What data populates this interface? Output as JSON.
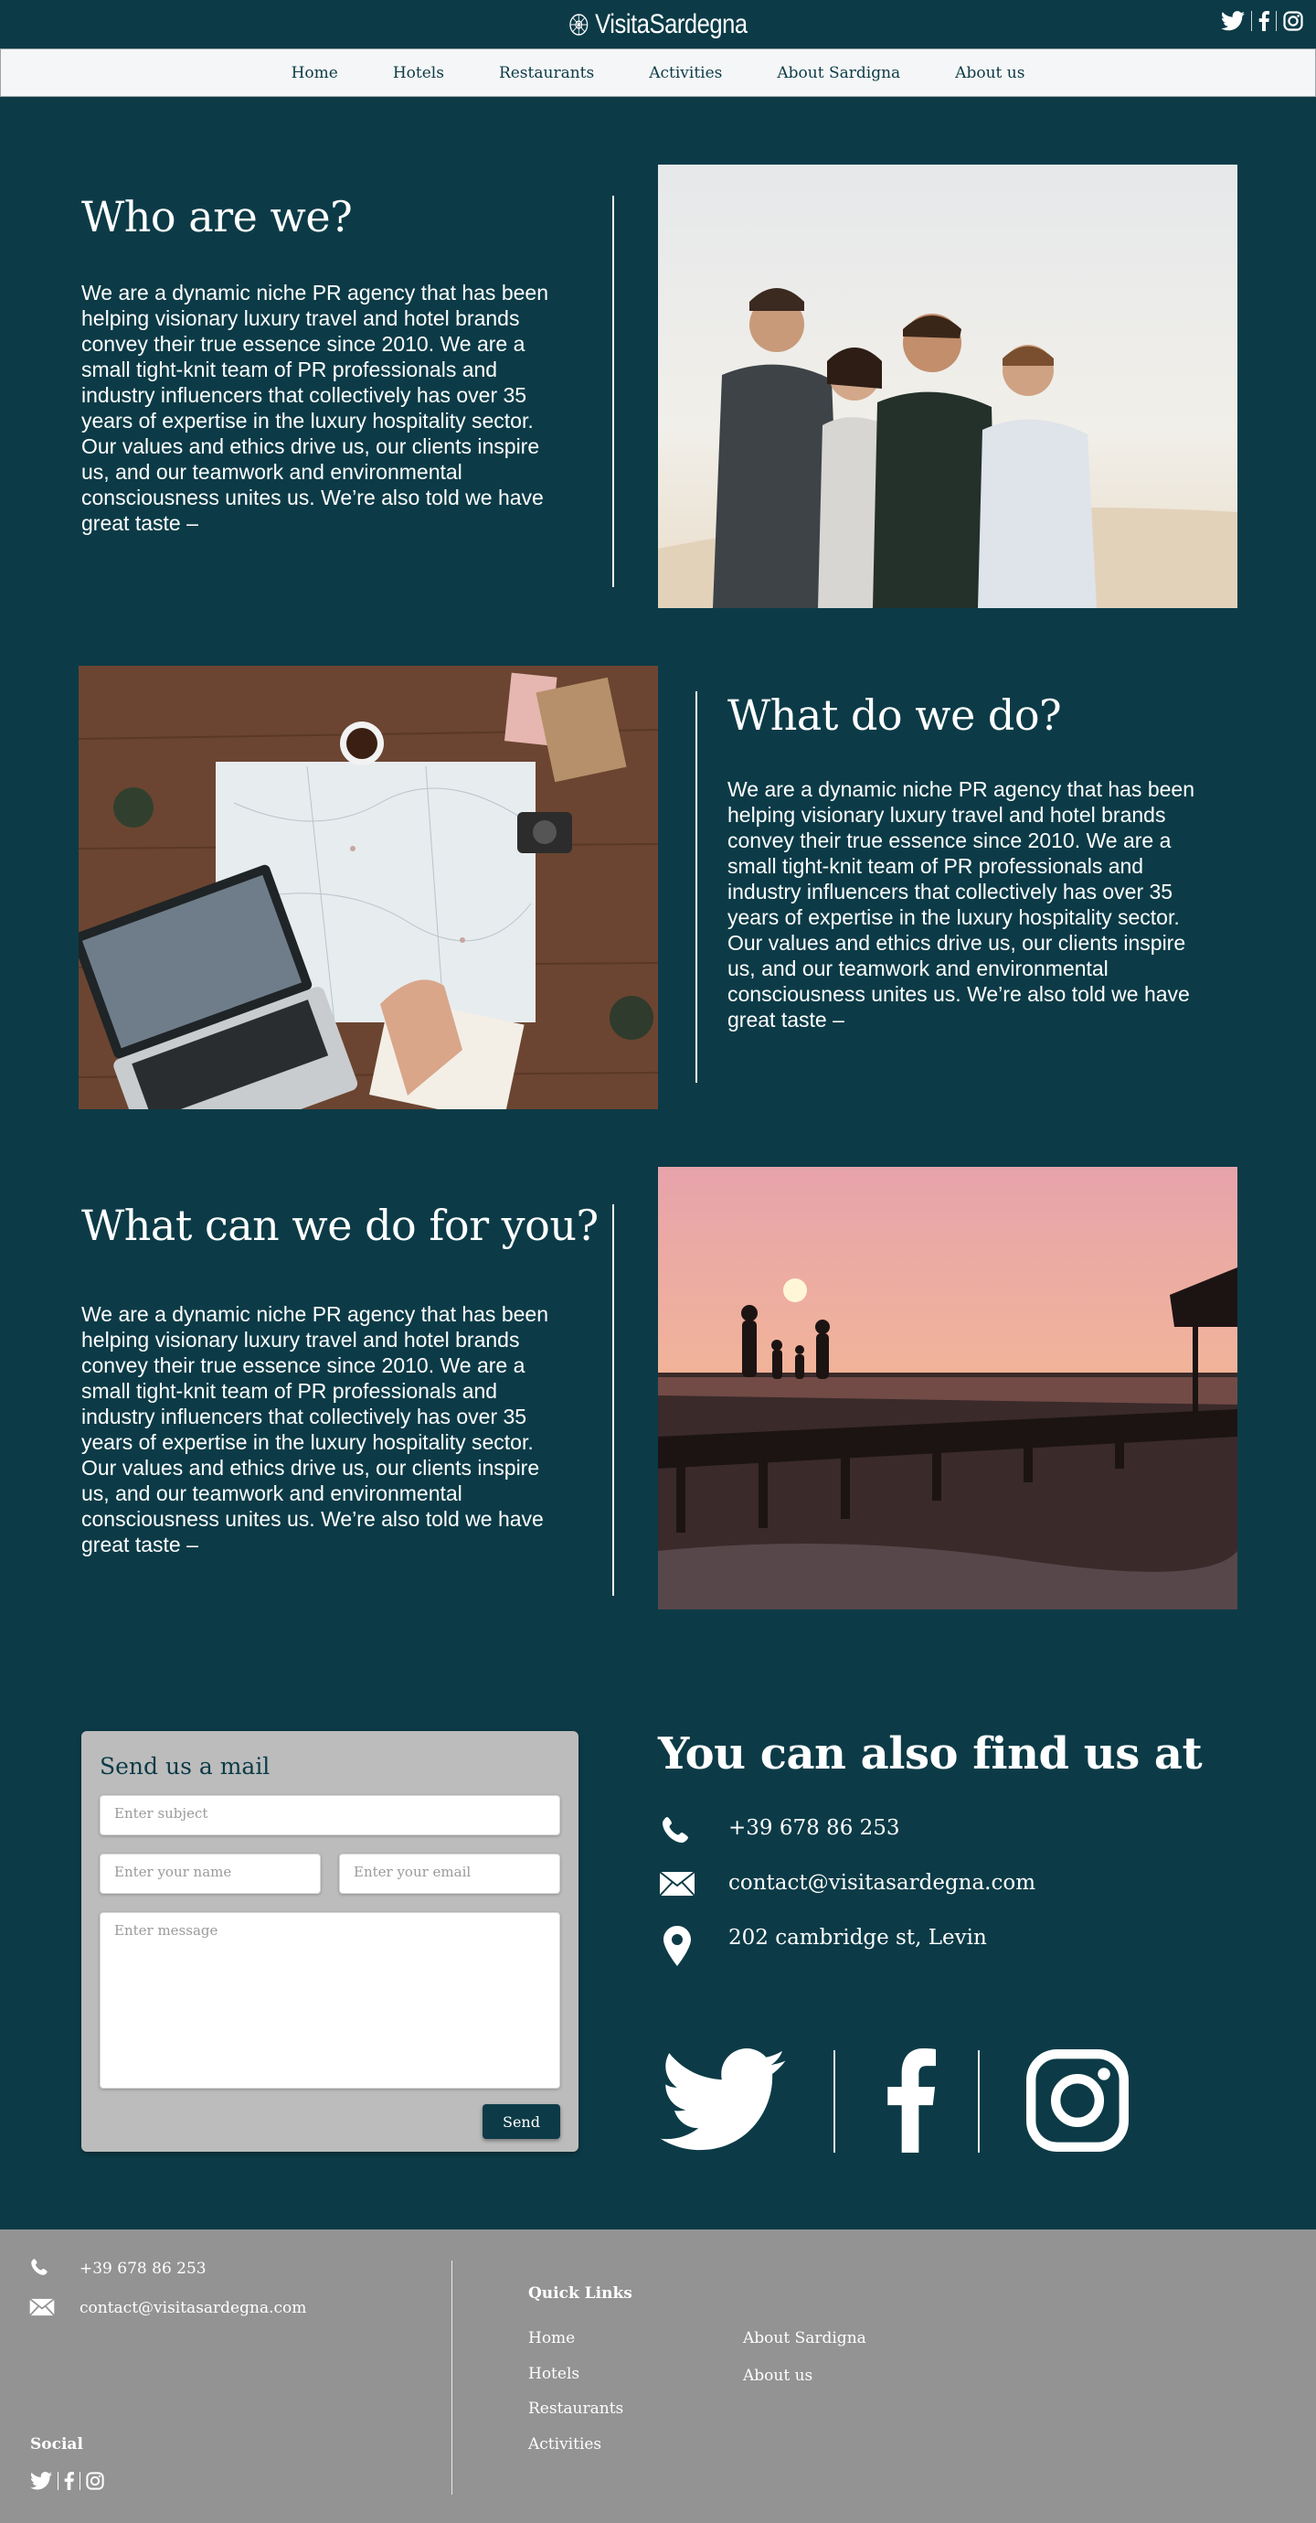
{
  "brand": {
    "name": "VisitaSardegna"
  },
  "nav": {
    "items": [
      "Home",
      "Hotels",
      "Restaurants",
      "Activities",
      "About Sardigna",
      "About us"
    ]
  },
  "sections": [
    {
      "title": "Who are we?",
      "body": "We are a dynamic niche PR agency that has been helping visionary luxury travel and hotel brands convey their true essence since 2010. We are a small tight-knit team of PR professionals and industry influencers that collectively has over 35 years of expertise in the luxury hospitality sector. Our values and ethics drive us, our clients inspire us, and our teamwork and environmental consciousness unites us. We’re also told we have great taste –",
      "image": "group-of-friends-photo"
    },
    {
      "title": "What do we do?",
      "body": "We are a dynamic niche PR agency that has been helping visionary luxury travel and hotel brands convey their true essence since 2010. We are a small tight-knit team of PR professionals and industry influencers that collectively has over 35 years of expertise in the luxury hospitality sector. Our values and ethics drive us, our clients inspire us, and our teamwork and environmental consciousness unites us. We’re also told we have great taste –",
      "image": "travel-planning-map-photo"
    },
    {
      "title": "What can we do for you?",
      "body": "We are a dynamic niche PR agency that has been helping visionary luxury travel and hotel brands convey their true essence since 2010. We are a small tight-knit team of PR professionals and industry influencers that collectively has over 35 years of expertise in the luxury hospitality sector. Our values and ethics drive us, our clients inspire us, and our teamwork and environmental consciousness unites us. We’re also told we have great taste –",
      "image": "sunset-pier-photo"
    }
  ],
  "mail_form": {
    "title": "Send us a mail",
    "subject_placeholder": "Enter subject",
    "name_placeholder": "Enter your name",
    "email_placeholder": "Enter your email",
    "message_placeholder": "Enter message",
    "send_label": "Send"
  },
  "find_us": {
    "title": "You can also find us at",
    "phone": "+39 678 86 253",
    "email": "contact@visitasardegna.com",
    "address": "202 cambridge st, Levin"
  },
  "footer": {
    "phone": "+39 678 86 253",
    "email": "contact@visitasardegna.com",
    "social_label": "Social",
    "quick_links_label": "Quick Links",
    "links_col1": [
      "Home",
      "Hotels",
      "Restaurants",
      "Activities"
    ],
    "links_col2": [
      "About Sardigna",
      "About us"
    ]
  },
  "colors": {
    "background": "#0c3b47",
    "nav_bg": "#f5f6f7",
    "card_bg": "#bcbcbc",
    "footer_bg": "#939393",
    "accent": "#0c3b47"
  },
  "icons": [
    "compass-logo-icon",
    "twitter-icon",
    "facebook-icon",
    "instagram-icon",
    "phone-icon",
    "envelope-icon",
    "map-pin-icon"
  ]
}
